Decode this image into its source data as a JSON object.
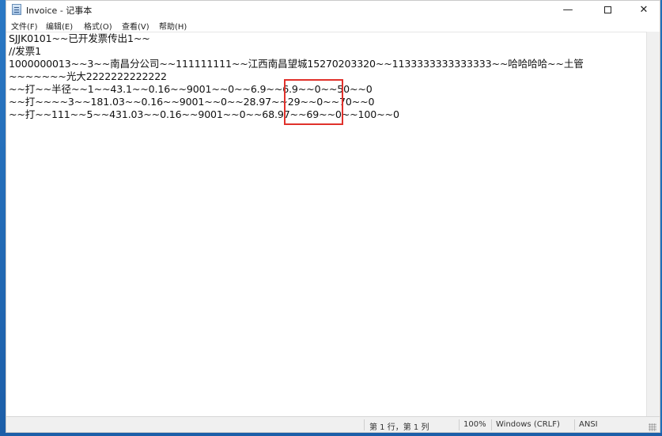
{
  "window": {
    "title": "Invoice - 记事本",
    "minimize_glyph": "—",
    "close_glyph": "✕"
  },
  "menu": [
    {
      "label": "文件(F)"
    },
    {
      "label": "编辑(E)"
    },
    {
      "label": "格式(O)"
    },
    {
      "label": "查看(V)"
    },
    {
      "label": "帮助(H)"
    }
  ],
  "document": {
    "lines": [
      "SJJK0101~~已开发票传出1~~",
      "//发票1",
      "1000000013~~3~~南昌分公司~~111111111~~江西南昌望城15270203320~~1133333333333333~~哈哈哈哈~~土管",
      "~~~~~~~光大2222222222222",
      "~~打~~半径~~1~~43.1~~0.16~~9001~~0~~6.9~~6.9~~0~~50~~0",
      "~~打~~~~3~~181.03~~0.16~~9001~~0~~28.97~~29~~0~~70~~0",
      "~~打~~111~~5~~431.03~~0.16~~9001~~0~~68.97~~69~~0~~100~~0"
    ]
  },
  "status": {
    "position": "第 1 行，第 1 列",
    "zoom": "100%",
    "line_ending": "Windows (CRLF)",
    "encoding": "ANSI"
  },
  "colors": {
    "highlight": "#e0312b",
    "desktop": "#1f6fb8"
  },
  "icons": [
    "notepad-icon",
    "size-grip-icon"
  ]
}
